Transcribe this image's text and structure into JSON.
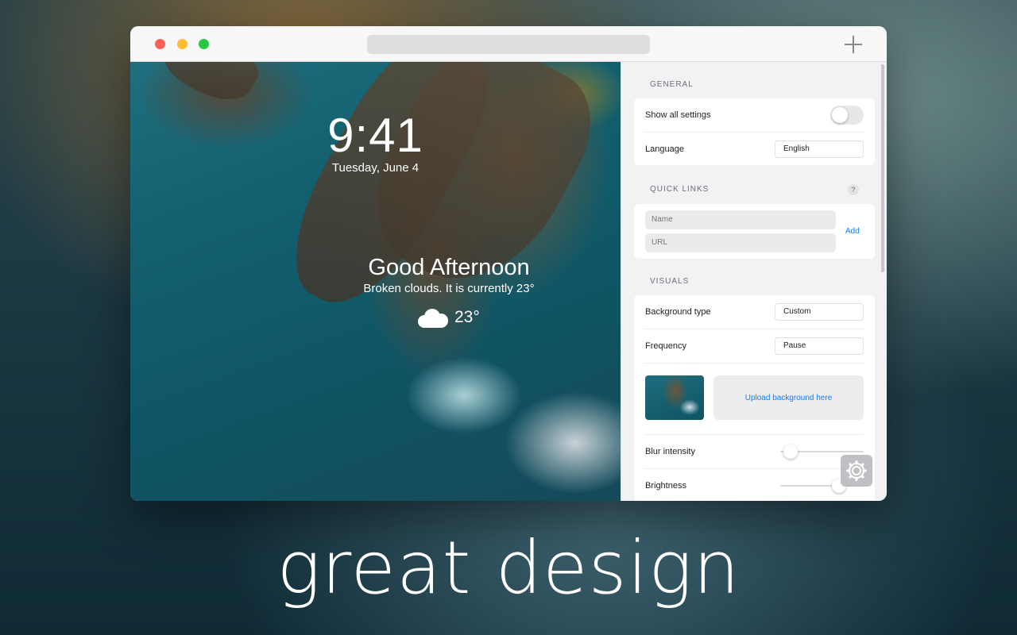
{
  "preview": {
    "time": "9:41",
    "date": "Tuesday, June 4",
    "greeting": "Good Afternoon",
    "weather_desc": "Broken clouds. It is currently 23°",
    "temperature": "23°",
    "weather_icon": "cloud-icon"
  },
  "settings": {
    "general": {
      "title": "GENERAL",
      "show_all_settings_label": "Show all settings",
      "show_all_settings_on": false,
      "language_label": "Language",
      "language_value": "English"
    },
    "quick_links": {
      "title": "QUICK LINKS",
      "help_icon": "?",
      "name_placeholder": "Name",
      "url_placeholder": "URL",
      "add_label": "Add"
    },
    "visuals": {
      "title": "VISUALS",
      "background_type_label": "Background type",
      "background_type_value": "Custom",
      "frequency_label": "Frequency",
      "frequency_value": "Pause",
      "upload_label": "Upload background here",
      "blur_label": "Blur intensity",
      "blur_value": 0.05,
      "brightness_label": "Brightness",
      "brightness_value": 0.75
    }
  },
  "tagline": "great design",
  "colors": {
    "accent": "#0a7cff",
    "close": "#fe5f57",
    "minimize": "#febc2e",
    "zoom": "#28c840"
  }
}
